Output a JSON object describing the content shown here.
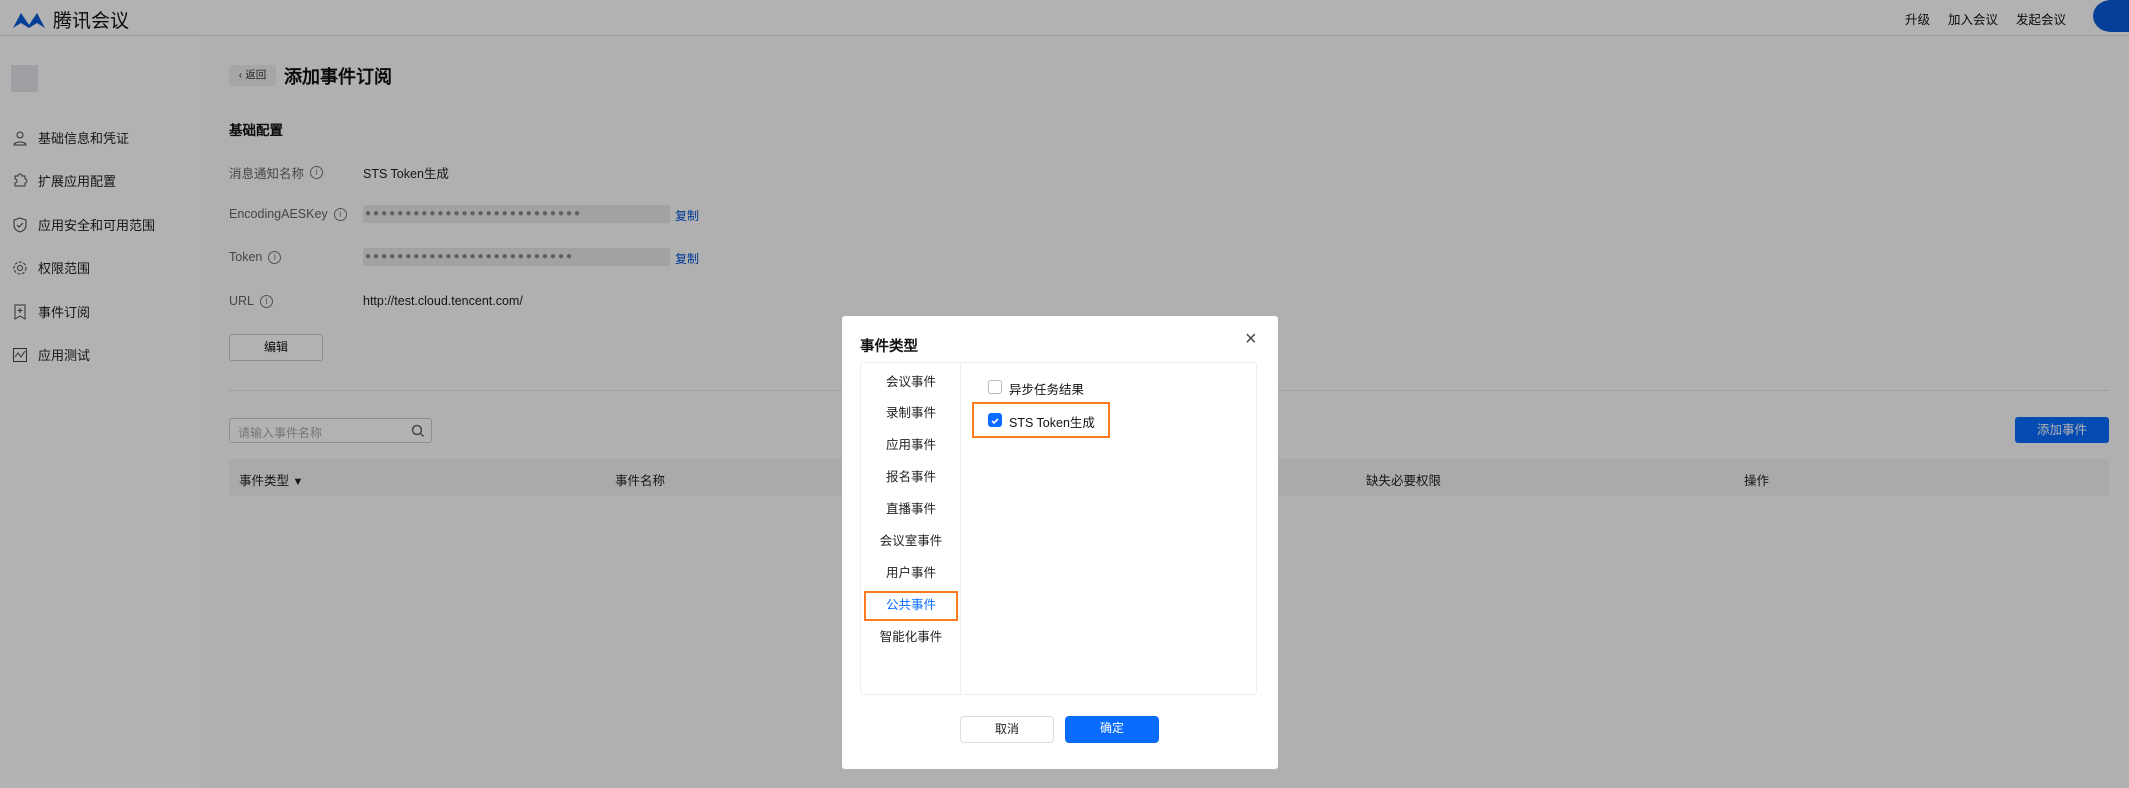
{
  "header": {
    "brand": "腾讯会议",
    "nav": [
      "升级",
      "加入会议",
      "发起会议"
    ]
  },
  "sidebar": {
    "items": [
      {
        "label": "基础信息和凭证",
        "icon": "user-icon"
      },
      {
        "label": "扩展应用配置",
        "icon": "puzzle-icon"
      },
      {
        "label": "应用安全和可用范围",
        "icon": "shield-icon"
      },
      {
        "label": "权限范围",
        "icon": "gear-icon"
      },
      {
        "label": "事件订阅",
        "icon": "bookmark-icon"
      },
      {
        "label": "应用测试",
        "icon": "chart-icon"
      }
    ]
  },
  "page": {
    "back_label": "返回",
    "title": "添加事件订阅",
    "section": "基础配置",
    "fields": {
      "name_label": "消息通知名称",
      "name_value": "STS Token生成",
      "aes_label": "EncodingAESKey",
      "aes_value": "●●●●●●●●●●●●●●●●●●●●●●●●●●●",
      "token_label": "Token",
      "token_value": "●●●●●●●●●●●●●●●●●●●●●●●●●●",
      "url_label": "URL",
      "url_value": "http://test.cloud.tencent.com/",
      "copy": "复制"
    },
    "edit_label": "编辑",
    "search_placeholder": "请输入事件名称",
    "add_event": "添加事件",
    "columns": [
      "事件类型",
      "事件名称",
      "缺失必要权限",
      "操作"
    ]
  },
  "modal": {
    "title": "事件类型",
    "categories": [
      "会议事件",
      "录制事件",
      "应用事件",
      "报名事件",
      "直播事件",
      "会议室事件",
      "用户事件",
      "公共事件",
      "智能化事件"
    ],
    "selected_category": "公共事件",
    "events": [
      {
        "label": "异步任务结果",
        "checked": false
      },
      {
        "label": "STS Token生成",
        "checked": true
      }
    ],
    "cancel": "取消",
    "confirm": "确定"
  },
  "colors": {
    "primary": "#0a6cff",
    "highlight": "#ff7a1f"
  }
}
